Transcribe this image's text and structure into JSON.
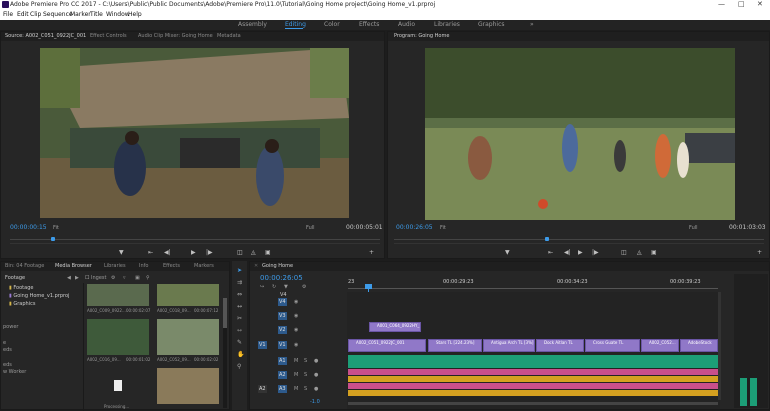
{
  "window": {
    "title": "Adobe Premiere Pro CC 2017 - C:\\Users\\Public\\Public Documents\\Adobe\\Premiere Pro\\11.0\\Tutorial\\Going Home project\\Going Home_v1.prproj"
  },
  "menu": [
    "File",
    "Edit",
    "Clip",
    "Sequence",
    "Marker",
    "Title",
    "Window",
    "Help"
  ],
  "workspaces": [
    "Assembly",
    "Editing",
    "Color",
    "Effects",
    "Audio",
    "Libraries",
    "Graphics",
    "»"
  ],
  "source": {
    "tabs": [
      "Source: A002_C051_0922JC_001",
      "Effect Controls",
      "Audio Clip Mixer: Going Home",
      "Metadata"
    ],
    "timecode": "00:00:00:15",
    "fit": "Fit",
    "quality": "Full",
    "duration": "00:00:05:01"
  },
  "program": {
    "tab": "Program: Going Home",
    "timecode": "00:00:26:05",
    "fit": "Fit",
    "quality": "Full",
    "duration": "00:01:03:03"
  },
  "project": {
    "tabs": [
      "Bin: 04 Footage",
      "Media Browser",
      "Libraries",
      "Info",
      "Effects",
      "Markers"
    ],
    "folder": "Footage",
    "ingest": "Ingest",
    "tree": [
      "Footage",
      "Going Home_v1.prproj",
      "Graphics"
    ],
    "side_labels": [
      "power",
      "e",
      "eds",
      "eds",
      "w Worker"
    ],
    "thumbs": [
      {
        "name": "A002_C009_0922...",
        "dur": "00:00:02:07"
      },
      {
        "name": "A002_C018_09...",
        "dur": "00:00:07:12"
      },
      {
        "name": "A002_C016_09...",
        "dur": "00:00:01:02"
      },
      {
        "name": "A002_C052_09...",
        "dur": "00:00:02:02"
      },
      {
        "name": "Processing...",
        "dur": ""
      },
      {
        "name": "",
        "dur": ""
      }
    ]
  },
  "timeline": {
    "tab": "Going Home",
    "timecode": "00:00:26:05",
    "ruler": [
      "23",
      "00:00:29:23",
      "00:00:34:23",
      "00:00:39:23"
    ],
    "tracks_v": [
      "V4",
      "V3",
      "V2",
      "V1"
    ],
    "tracks_a": [
      "A1",
      "A2",
      "A3"
    ],
    "source_v": "V1",
    "source_a": "A2",
    "clips_v2": [
      "A001_C064_0922HY_"
    ],
    "clips_v1": [
      "A002_C051_0922JC_001",
      "Stars TL [224.23%]",
      "Antigua Arch TL [3%]",
      "Dock Aitlan TL",
      "Cross Guate TL",
      "A002_C052...",
      "AdobeStock"
    ],
    "volume": "-1.0"
  },
  "colors": {
    "accent": "#3d9be9",
    "video_clip": "#9078c8",
    "audio_green": "#1c9e77",
    "audio_pink": "#c94f8b",
    "audio_gold": "#d4a020"
  }
}
